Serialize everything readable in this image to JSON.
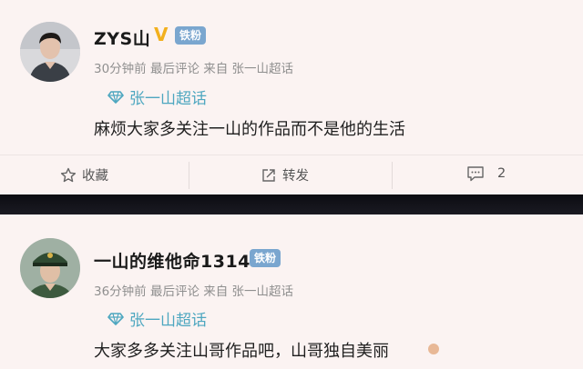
{
  "posts": [
    {
      "username": "ZYS山",
      "verified_mark": "V",
      "fan_badge": "铁粉",
      "meta": "30分钟前  最后评论  来自 张一山超话",
      "topic": "张一山超话",
      "content": "麻烦大家多关注一山的作品而不是他的生活",
      "actions": {
        "favorite": "收藏",
        "repost": "转发",
        "comments": "2"
      }
    },
    {
      "username": "一山的维他命1314",
      "fan_badge": "铁粉",
      "meta": "36分钟前  最后评论  来自 张一山超话",
      "topic": "张一山超话",
      "content": "大家多多关注山哥作品吧，山哥独自美丽"
    }
  ],
  "colors": {
    "background": "#fbf3f2",
    "topic": "#4ea7c0",
    "fan_badge": "#7aa6cf",
    "verified": "#f2b01e",
    "meta": "#8f8f8f"
  },
  "icons": [
    "diamond-topic-icon",
    "star-icon",
    "share-icon",
    "comment-icon"
  ]
}
